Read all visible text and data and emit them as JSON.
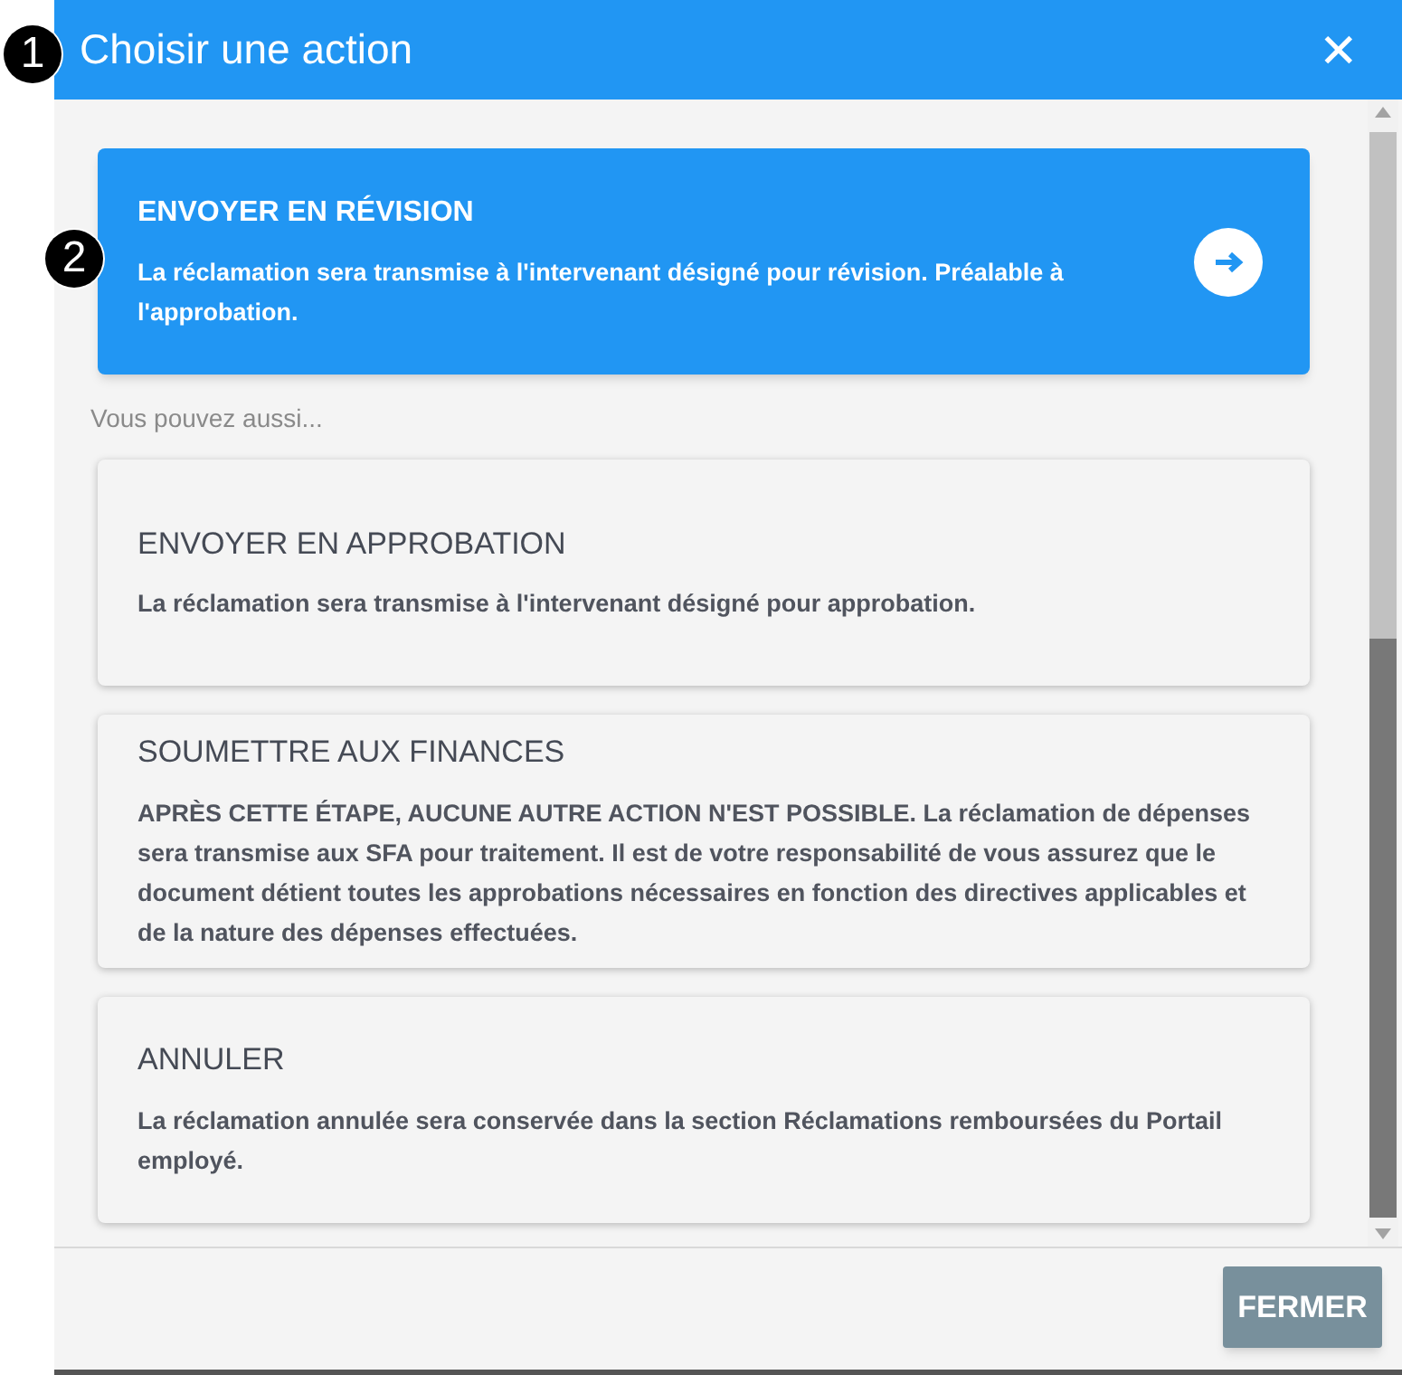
{
  "dialog": {
    "title": "Choisir une action",
    "close_label": "✕"
  },
  "callouts": [
    {
      "label": "1"
    },
    {
      "label": "2"
    }
  ],
  "actions": [
    {
      "title": "ENVOYER EN RÉVISION",
      "description": "La réclamation sera transmise à l'intervenant désigné pour révision. Préalable à l'approbation.",
      "selected": true
    },
    {
      "title": "ENVOYER EN APPROBATION",
      "description": "La réclamation sera transmise à l'intervenant désigné pour approbation.",
      "selected": false
    },
    {
      "title": "SOUMETTRE AUX FINANCES",
      "description": "APRÈS CETTE ÉTAPE, AUCUNE AUTRE ACTION N'EST POSSIBLE. La réclamation de dépenses sera transmise aux SFA pour traitement. Il est de votre responsabilité de vous assurez que le document détient toutes les approbations nécessaires en fonction des directives applicables et de la nature des dépenses effectuées.",
      "selected": false
    },
    {
      "title": "ANNULER",
      "description": "La réclamation annulée sera conservée dans la section Réclamations remboursées du Portail employé.",
      "selected": false
    }
  ],
  "also_label": "Vous pouvez aussi...",
  "footer": {
    "button": "FERMER"
  }
}
